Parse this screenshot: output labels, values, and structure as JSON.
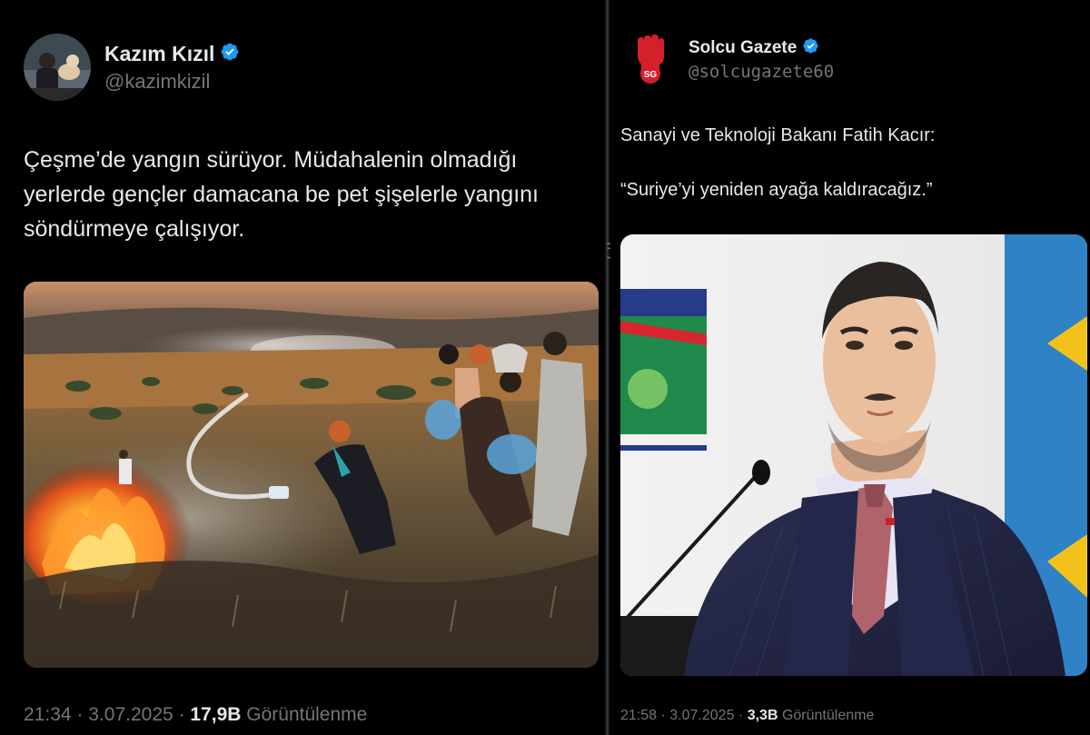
{
  "left_tweet": {
    "author_name": "Kazım Kızıl",
    "handle": "@kazimkizil",
    "text": "Çeşme’de yangın sürüyor. Müdahalenin olmadığı yerlerde gençler damacana be pet şişelerle yangını söndürmeye çalışıyor.",
    "time": "21:34",
    "date": "3.07.2025",
    "views_count": "17,9B",
    "views_label": "Görüntülenme",
    "separator": "·",
    "verified_icon": "verified-badge-icon",
    "media_description": "wildfire-photo"
  },
  "right_tweet": {
    "author_name": "Solcu Gazete",
    "handle": "@solcugazete60",
    "text_line1": "Sanayi ve Teknoloji Bakanı Fatih Kacır:",
    "text_line2": "“Suriye’yi yeniden ayağa kaldıracağız.”",
    "time": "21:58",
    "date": "3.07.2025",
    "views_count": "3,3B",
    "views_label": "Görüntülenme",
    "separator": "·",
    "verified_icon": "verified-badge-icon",
    "logo_text": "SG",
    "media_description": "minister-photo"
  },
  "watermark": "Shqppln",
  "colors": {
    "background": "#000000",
    "text_primary": "#e7e9ea",
    "text_secondary": "#71767b",
    "verified_blue": "#1d9bf0",
    "logo_red": "#d4202a"
  }
}
